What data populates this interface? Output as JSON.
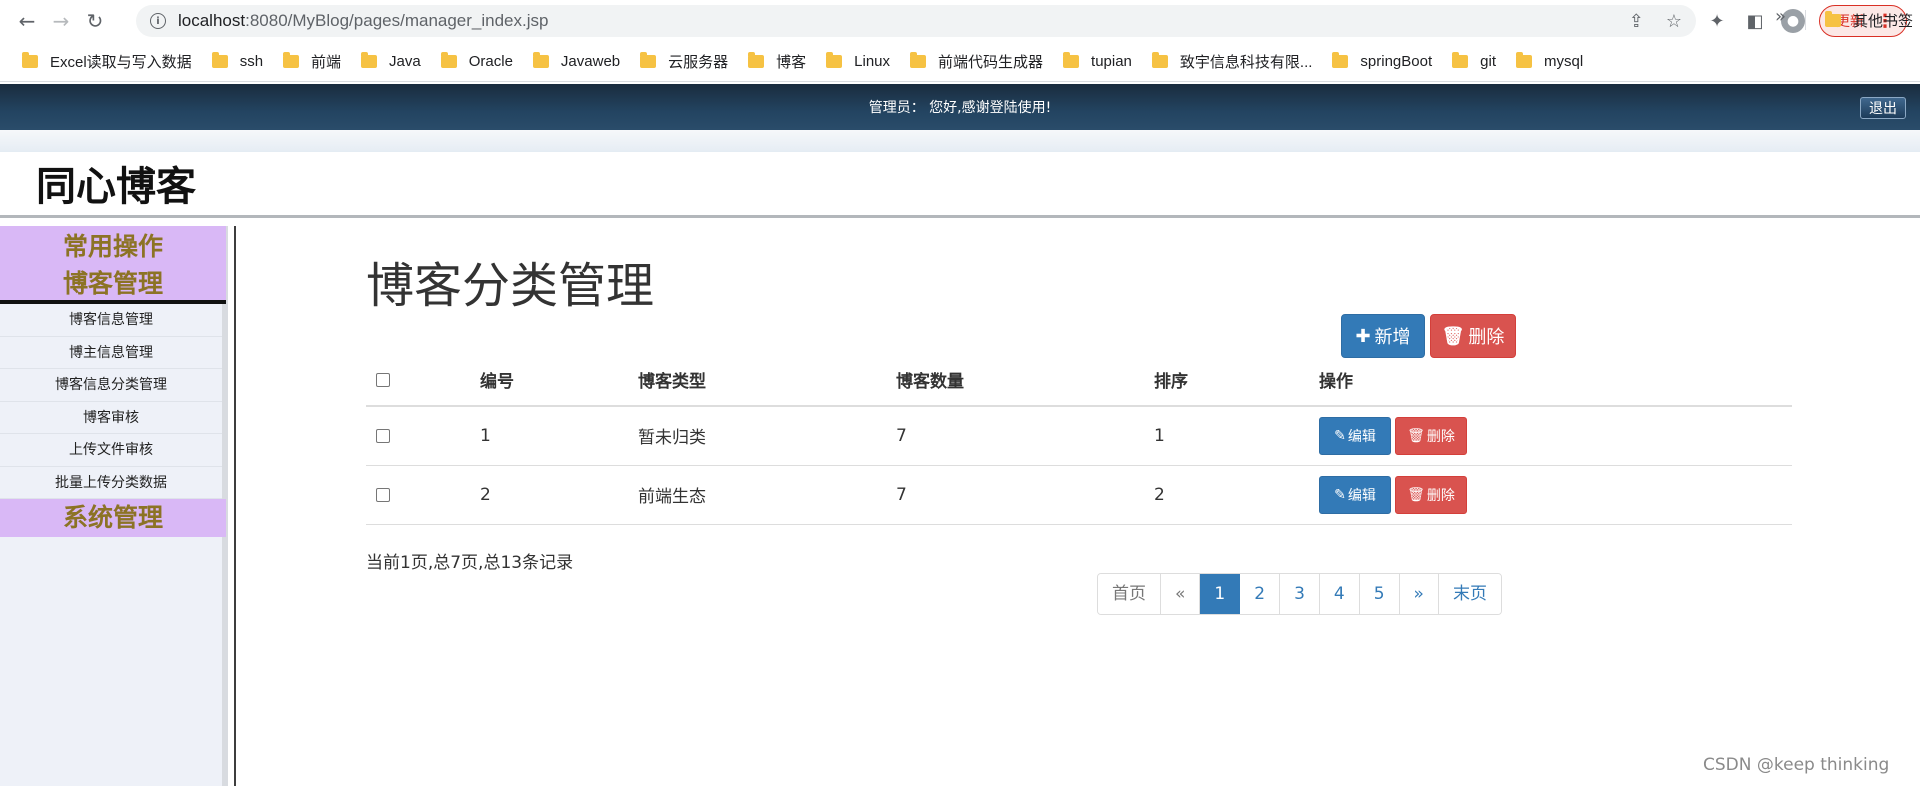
{
  "browser": {
    "url_host": "localhost",
    "url_path": ":8080/MyBlog/pages/manager_index.jsp",
    "update_label": "更新",
    "bookmarks": [
      "Excel读取与写入数据",
      "ssh",
      "前端",
      "Java",
      "Oracle",
      "Javaweb",
      "云服务器",
      "博客",
      "Linux",
      "前端代码生成器",
      "tupian",
      "致宇信息科技有限...",
      "springBoot",
      "git",
      "mysql"
    ],
    "other_bookmarks": "其他书签"
  },
  "header": {
    "admin_text": "管理员： 您好,感谢登陆使用!",
    "logout_label": "退出",
    "site_title": "同心博客"
  },
  "sidebar": {
    "head1": "常用操作",
    "head2": "博客管理",
    "items": [
      "博客信息管理",
      "博主信息管理",
      "博客信息分类管理",
      "博客审核",
      "上传文件审核",
      "批量上传分类数据"
    ],
    "head3": "系统管理"
  },
  "main": {
    "heading": "博客分类管理",
    "add_label": "新增",
    "delete_label": "删除",
    "columns": [
      "编号",
      "博客类型",
      "博客数量",
      "排序",
      "操作"
    ],
    "rows": [
      {
        "id": "1",
        "type": "暂未归类",
        "count": "7",
        "order": "1"
      },
      {
        "id": "2",
        "type": "前端生态",
        "count": "7",
        "order": "2"
      }
    ],
    "row_edit_label": "编辑",
    "row_delete_label": "删除",
    "summary": "当前1页,总7页,总13条记录",
    "pager": {
      "first": "首页",
      "prev": "«",
      "pages": [
        "1",
        "2",
        "3",
        "4",
        "5"
      ],
      "next": "»",
      "last": "末页",
      "current": "1"
    }
  },
  "watermark": "CSDN @keep   thinking"
}
